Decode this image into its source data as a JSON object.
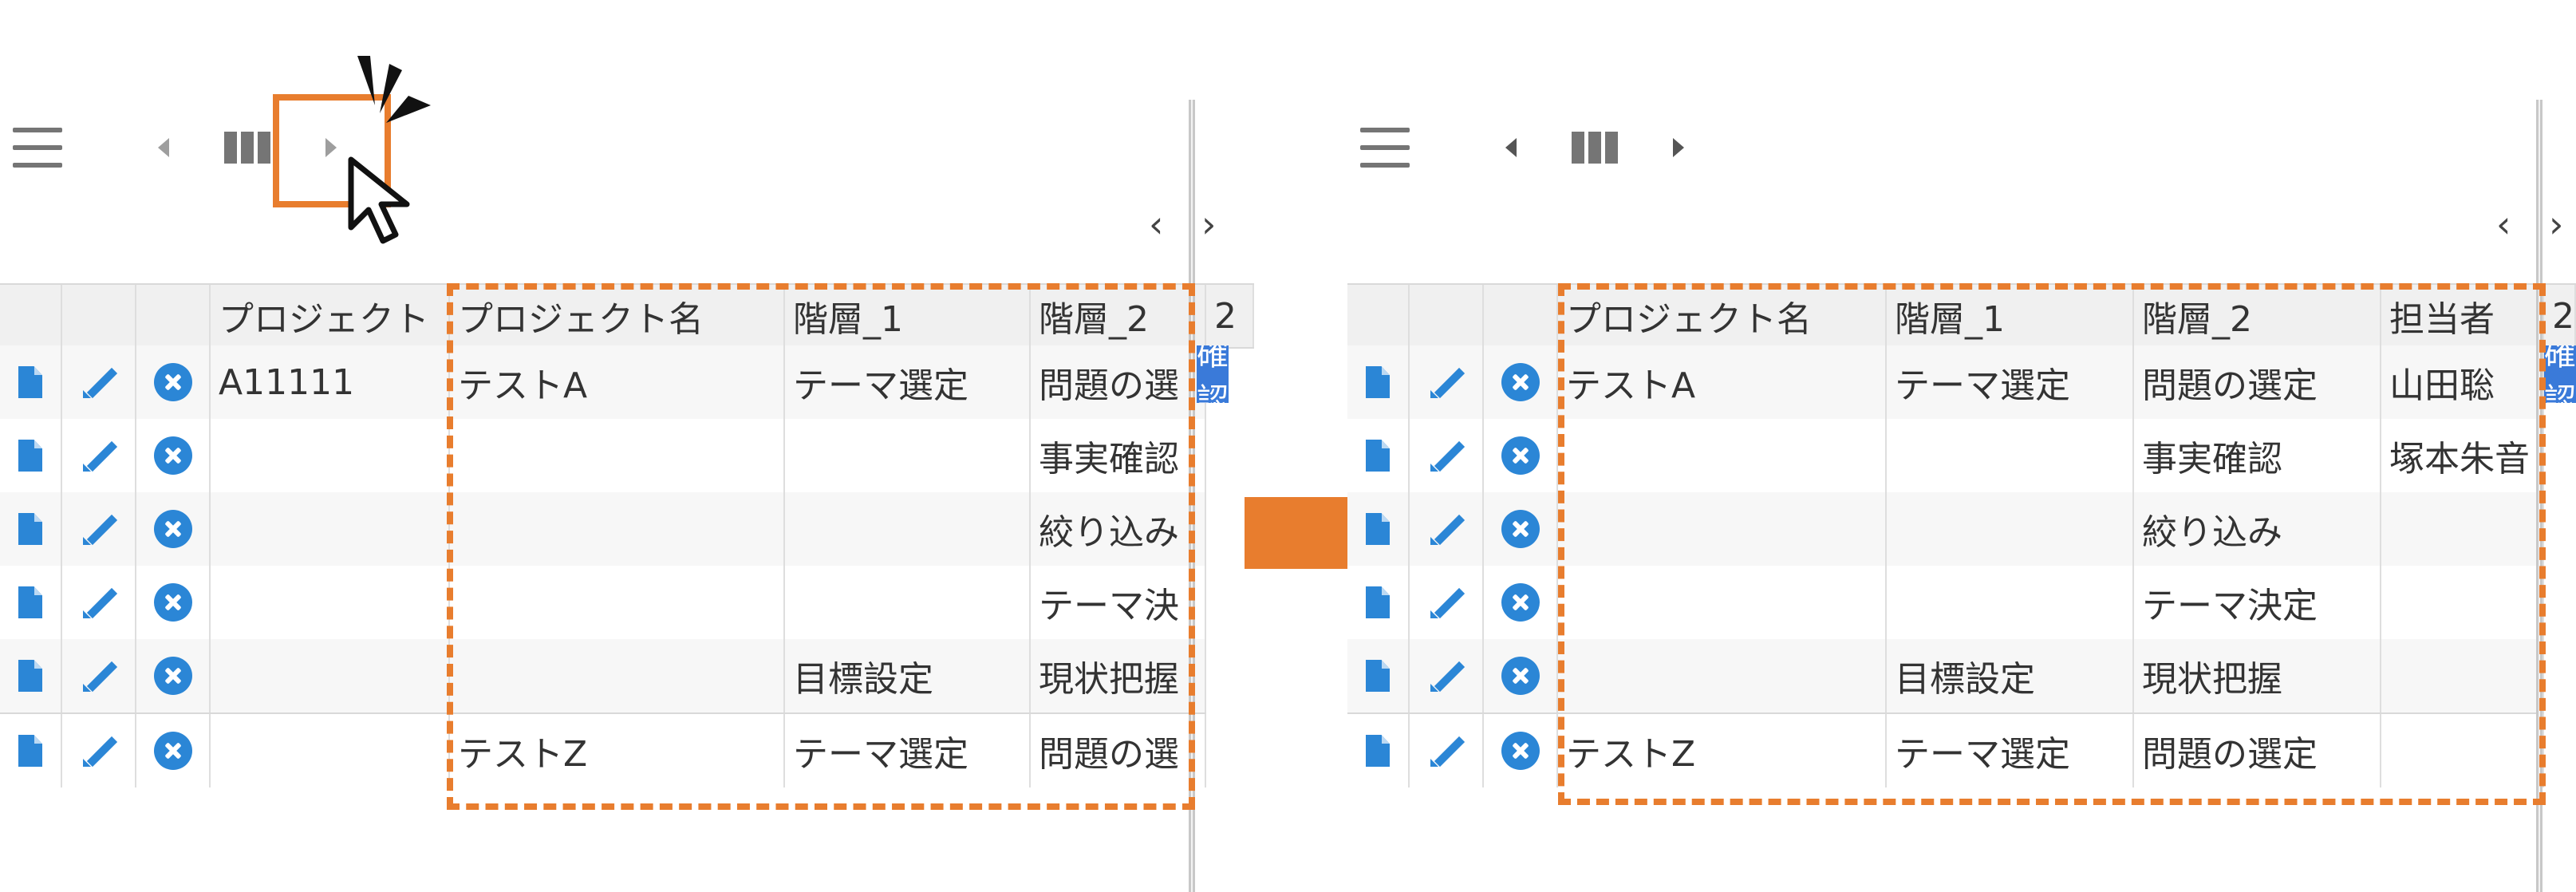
{
  "left": {
    "header": [
      "",
      "",
      "",
      "プロジェクト",
      "プロジェクト名",
      "階層_1",
      "階層_2",
      "2"
    ],
    "rows": [
      [
        "A11111",
        "テストA",
        "テーマ選定",
        "問題の選"
      ],
      [
        "",
        "",
        "",
        "事実確認"
      ],
      [
        "",
        "",
        "",
        "絞り込み"
      ],
      [
        "",
        "",
        "",
        "テーマ決"
      ],
      [
        "",
        "",
        "目標設定",
        "現状把握"
      ],
      [
        "",
        "テストZ",
        "テーマ選定",
        "問題の選"
      ]
    ],
    "tag": "確認",
    "scroll_prev": "‹",
    "scroll_next": "›"
  },
  "right": {
    "header": [
      "",
      "",
      "",
      "プロジェクト名",
      "階層_1",
      "階層_2",
      "担当者",
      "2"
    ],
    "rows": [
      [
        "テストA",
        "テーマ選定",
        "問題の選定",
        "山田聡"
      ],
      [
        "",
        "",
        "事実確認",
        "塚本朱音"
      ],
      [
        "",
        "",
        "絞り込み",
        ""
      ],
      [
        "",
        "",
        "テーマ決定",
        ""
      ],
      [
        "",
        "目標設定",
        "現状把握",
        ""
      ],
      [
        "テストZ",
        "テーマ選定",
        "問題の選定",
        ""
      ]
    ],
    "tag": "確認",
    "scroll_prev": "‹",
    "scroll_next": "›"
  },
  "icons": {
    "row_icons": [
      "document-icon",
      "edit-pencil-icon",
      "cancel-circle-icon"
    ],
    "toolbar": [
      "hamburger-menu-icon",
      "nav-prev-icon",
      "columns-icon",
      "nav-next-icon"
    ],
    "annotations": [
      "mouse-cursor-icon",
      "click-burst-icon",
      "transition-arrow-icon"
    ]
  },
  "colors": {
    "accent_orange": "#e87d2e",
    "icon_blue": "#2b86d6",
    "tag_blue": "#3a7ad9"
  }
}
